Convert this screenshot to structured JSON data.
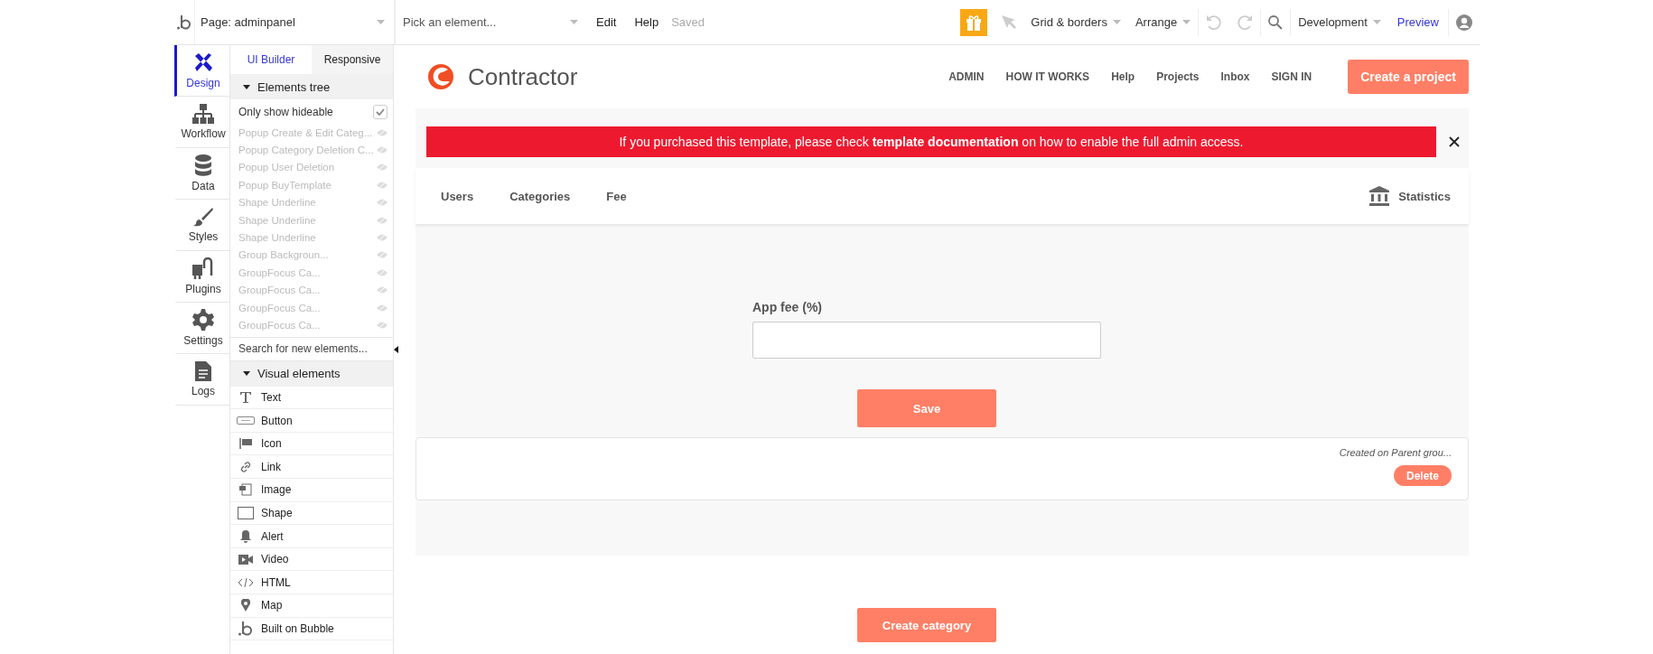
{
  "topbar": {
    "page_select": "Page: adminpanel",
    "element_select": {
      "placeholder": "Pick an element..."
    },
    "menu": [
      "Edit",
      "Help"
    ],
    "status": "Saved",
    "tools": [
      "Grid & borders",
      "Arrange"
    ],
    "mode": "Development",
    "preview": "Preview"
  },
  "side_tabs": [
    {
      "kind": "design",
      "label": "Design",
      "selected": true
    },
    {
      "kind": "workflow",
      "label": "Workflow",
      "selected": false
    },
    {
      "kind": "data",
      "label": "Data",
      "selected": false
    },
    {
      "kind": "styles",
      "label": "Styles",
      "selected": false
    },
    {
      "kind": "plugins",
      "label": "Plugins",
      "selected": false
    },
    {
      "kind": "settings",
      "label": "Settings",
      "selected": false
    },
    {
      "kind": "logs",
      "label": "Logs",
      "selected": false
    }
  ],
  "panel": {
    "tabs": [
      {
        "label": "UI Builder",
        "selected": true
      },
      {
        "label": "Responsive",
        "selected": false
      }
    ],
    "tree_title": "Elements tree",
    "tree_expanded": true,
    "only_show_hideable": {
      "label": "Only show hideable",
      "checked": true
    },
    "tree_items": [
      "Popup Create & Edit Categ...",
      "Popup Category Deletion C...",
      "Popup User Deletion",
      "Popup BuyTemplate",
      "Shape Underline",
      "Shape Underline",
      "Shape Underline",
      "Group Backgroun...",
      "GroupFocus Ca...",
      "GroupFocus Ca...",
      "GroupFocus Ca...",
      "GroupFocus Ca..."
    ],
    "search": {
      "placeholder": "Search for new elements..."
    },
    "visual_title": "Visual elements",
    "visual_expanded": true,
    "elements": [
      {
        "kind": "text",
        "label": "Text"
      },
      {
        "kind": "button",
        "label": "Button"
      },
      {
        "kind": "icon",
        "label": "Icon"
      },
      {
        "kind": "link",
        "label": "Link"
      },
      {
        "kind": "image",
        "label": "Image"
      },
      {
        "kind": "shape",
        "label": "Shape"
      },
      {
        "kind": "alert",
        "label": "Alert"
      },
      {
        "kind": "video",
        "label": "Video"
      },
      {
        "kind": "html",
        "label": "HTML"
      },
      {
        "kind": "map",
        "label": "Map"
      },
      {
        "kind": "bubble",
        "label": "Built on Bubble"
      }
    ]
  },
  "canvas": {
    "brand": "Contractor",
    "nav": [
      "ADMIN",
      "HOW IT WORKS",
      "Help",
      "Projects",
      "Inbox",
      "SIGN IN"
    ],
    "cta": "Create a project",
    "banner": "If you purchased this template, please check **template documentation** on how to enable the full admin access.",
    "admin_tabs": [
      "Users",
      "Categories",
      "Fee"
    ],
    "stats": "Statistics",
    "fee_label": "App fee (%)",
    "save": "Save",
    "card": {
      "meta": "Created on Parent grou...",
      "delete": "Delete"
    },
    "create": "Create category"
  }
}
